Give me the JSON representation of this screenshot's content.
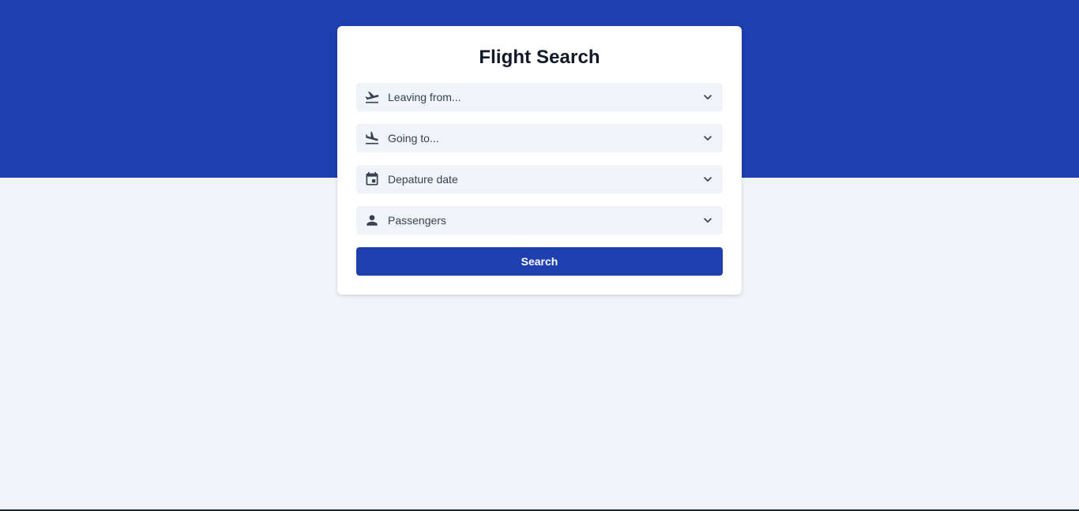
{
  "colors": {
    "brand": "#1e40af",
    "page_background": "#f0f3f8",
    "card_background": "#ffffff",
    "field_background": "#f0f3f8",
    "text_primary": "#111827",
    "text_secondary": "#374151"
  },
  "form": {
    "title": "Flight Search",
    "fields": [
      {
        "icon": "flight-takeoff-icon",
        "label": "Leaving from..."
      },
      {
        "icon": "flight-land-icon",
        "label": "Going to..."
      },
      {
        "icon": "calendar-icon",
        "label": "Depature date"
      },
      {
        "icon": "person-icon",
        "label": "Passengers"
      }
    ],
    "search_label": "Search"
  }
}
